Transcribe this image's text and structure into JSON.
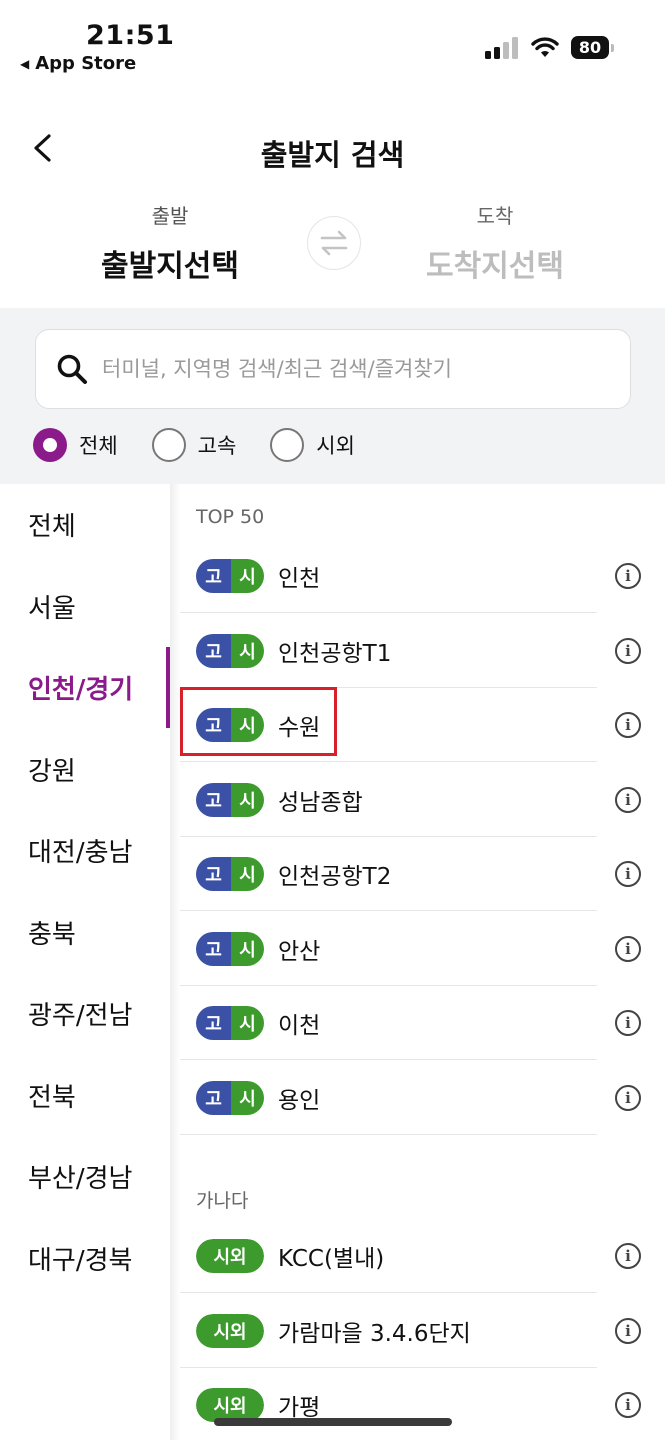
{
  "status_bar": {
    "time": "21:51",
    "back_app": "App Store",
    "battery": "80"
  },
  "header": {
    "title": "출발지 검색"
  },
  "route": {
    "depart_label": "출발",
    "depart_value": "출발지선택",
    "arrive_label": "도착",
    "arrive_value": "도착지선택"
  },
  "search": {
    "placeholder": "터미널, 지역명 검색/최근 검색/즐겨찾기"
  },
  "filters": [
    {
      "label": "전체",
      "checked": true
    },
    {
      "label": "고속",
      "checked": false
    },
    {
      "label": "시외",
      "checked": false
    }
  ],
  "regions": [
    "전체",
    "서울",
    "인천/경기",
    "강원",
    "대전/충남",
    "충북",
    "광주/전남",
    "전북",
    "부산/경남",
    "대구/경북"
  ],
  "active_region": "인천/경기",
  "sections": {
    "top50": "TOP 50",
    "ganada": "가나다"
  },
  "badges": {
    "go": "고",
    "si": "시",
    "sioe": "시외"
  },
  "top50_terminals": [
    "인천",
    "인천공항T1",
    "수원",
    "성남종합",
    "인천공항T2",
    "안산",
    "이천",
    "용인"
  ],
  "ganada_terminals": [
    "KCC(별내)",
    "가람마을 3.4.6단지",
    "가평"
  ],
  "info_glyph": "i",
  "highlighted_terminal": "수원",
  "colors": {
    "accent": "#8b1a8b",
    "express_badge": "#3b51a5",
    "intercity_badge": "#3d9a2d",
    "highlight": "#d8202a"
  }
}
